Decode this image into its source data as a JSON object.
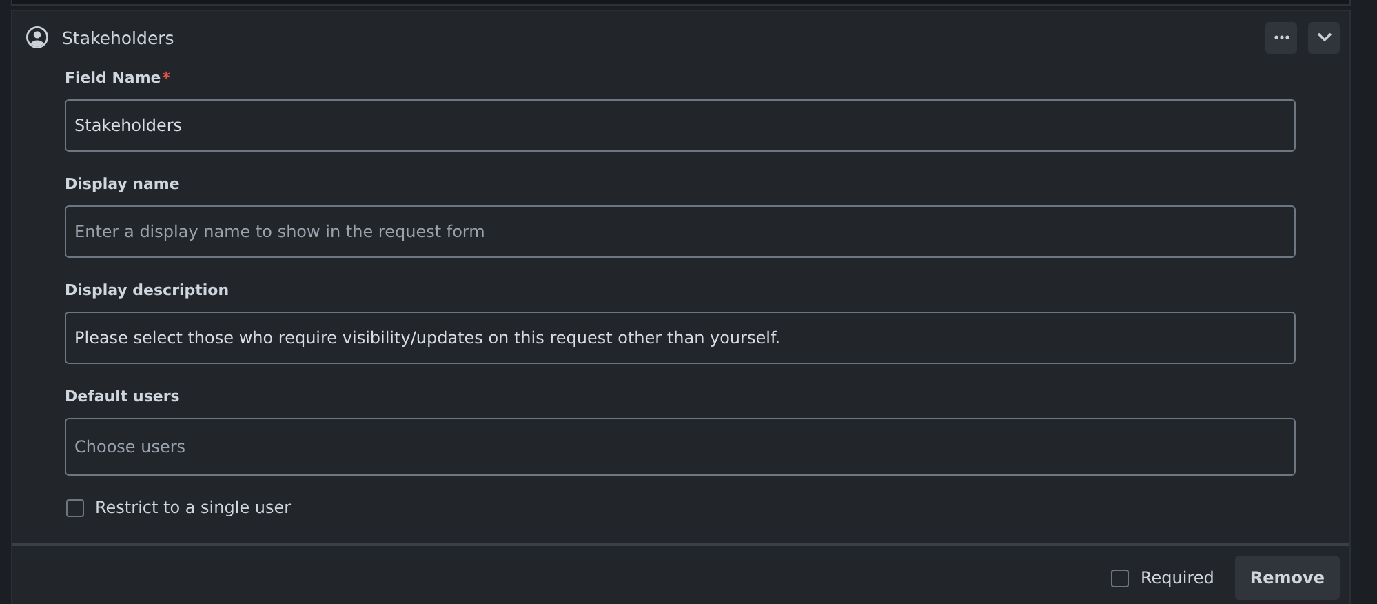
{
  "panel": {
    "title": "Stakeholders"
  },
  "fields": [
    {
      "label": "Field Name",
      "required_mark": "*",
      "value": "Stakeholders",
      "kind": "text"
    },
    {
      "label": "Display name",
      "placeholder": "Enter a display name to show in the request form",
      "kind": "text"
    },
    {
      "label": "Display description",
      "value": "Please select those who require visibility/updates on this request other than yourself.",
      "kind": "text"
    },
    {
      "label": "Default users",
      "placeholder": "Choose users",
      "kind": "picker"
    }
  ],
  "restrict": {
    "label": "Restrict to a single user",
    "checked": false
  },
  "footer": {
    "required": {
      "label": "Required",
      "checked": false
    },
    "remove_button": "Remove"
  }
}
